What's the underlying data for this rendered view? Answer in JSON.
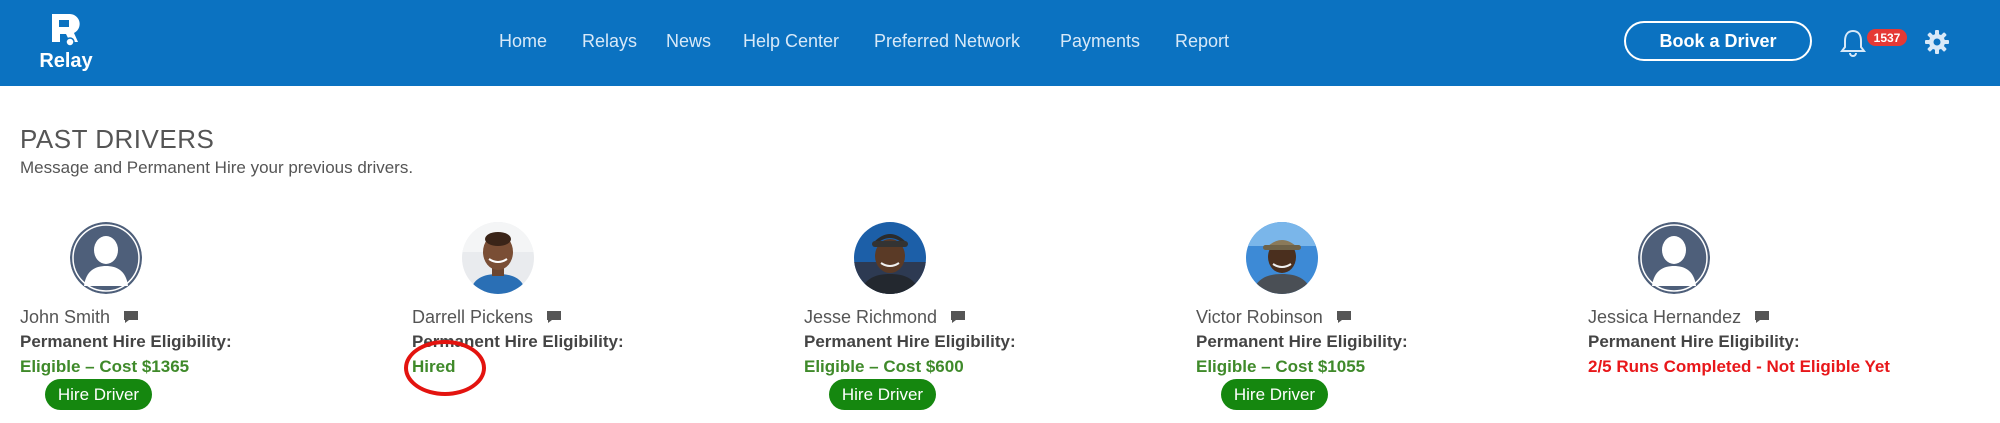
{
  "header": {
    "logo_text": "Relay",
    "nav": [
      "Home",
      "Relays",
      "News",
      "Help Center",
      "Preferred Network",
      "Payments",
      "Report"
    ],
    "book_button": "Book a Driver",
    "notification_count": "1537",
    "icons": {
      "bell": "bell-icon",
      "settings": "gear-icon",
      "chat": "chat-bubble-icon"
    },
    "colors": {
      "primary": "#0b72c1",
      "hire_button": "#15870f",
      "eligible": "#3f8a2a",
      "not_eligible": "#e8171a",
      "badge": "#e53935"
    }
  },
  "page": {
    "title": "PAST DRIVERS",
    "subtitle": "Message and Permanent Hire your previous drivers."
  },
  "drivers": [
    {
      "name": "John Smith",
      "eligibility_label": "Permanent Hire Eligibility:",
      "status": "Eligible – Cost $1365",
      "status_type": "eligible",
      "button": "Hire Driver",
      "avatar": "default"
    },
    {
      "name": "Darrell Pickens",
      "eligibility_label": "Permanent Hire Eligibility:",
      "status": "Hired",
      "status_type": "hired",
      "button": "",
      "avatar": "photo"
    },
    {
      "name": "Jesse Richmond",
      "eligibility_label": "Permanent Hire Eligibility:",
      "status": "Eligible – Cost $600",
      "status_type": "eligible",
      "button": "Hire Driver",
      "avatar": "photo"
    },
    {
      "name": "Victor Robinson",
      "eligibility_label": "Permanent Hire Eligibility:",
      "status": "Eligible – Cost $1055",
      "status_type": "eligible",
      "button": "Hire Driver",
      "avatar": "photo"
    },
    {
      "name": "Jessica Hernandez",
      "eligibility_label": "Permanent Hire Eligibility:",
      "status": "2/5 Runs Completed - Not Eligible Yet",
      "status_type": "not_eligible",
      "button": "",
      "avatar": "default"
    }
  ]
}
